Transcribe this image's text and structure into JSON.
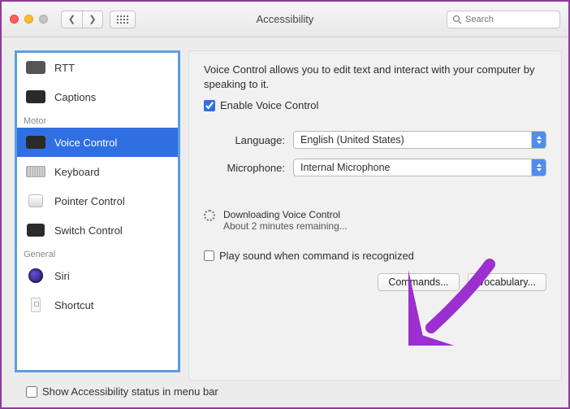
{
  "window": {
    "title": "Accessibility"
  },
  "search": {
    "placeholder": "Search"
  },
  "sidebar": {
    "groups": [
      {
        "label": "",
        "items": [
          {
            "id": "rtt",
            "label": "RTT"
          },
          {
            "id": "captions",
            "label": "Captions"
          }
        ]
      },
      {
        "label": "Motor",
        "items": [
          {
            "id": "voice-control",
            "label": "Voice Control",
            "selected": true
          },
          {
            "id": "keyboard",
            "label": "Keyboard"
          },
          {
            "id": "pointer-control",
            "label": "Pointer Control"
          },
          {
            "id": "switch-control",
            "label": "Switch Control"
          }
        ]
      },
      {
        "label": "General",
        "items": [
          {
            "id": "siri",
            "label": "Siri"
          },
          {
            "id": "shortcut",
            "label": "Shortcut"
          }
        ]
      }
    ]
  },
  "main": {
    "intro": "Voice Control allows you to edit text and interact with your computer by speaking to it.",
    "enable_label": "Enable Voice Control",
    "enable_checked": true,
    "language_label": "Language:",
    "language_value": "English (United States)",
    "microphone_label": "Microphone:",
    "microphone_value": "Internal Microphone",
    "download_status": "Downloading Voice Control",
    "download_substatus": "About 2 minutes remaining...",
    "play_sound_label": "Play sound when command is recognized",
    "play_sound_checked": false,
    "commands_btn": "Commands...",
    "vocabulary_btn": "Vocabulary..."
  },
  "footer": {
    "show_status_label": "Show Accessibility status in menu bar",
    "show_status_checked": false
  },
  "annotation": {
    "arrow_color": "#9b2fcf"
  }
}
